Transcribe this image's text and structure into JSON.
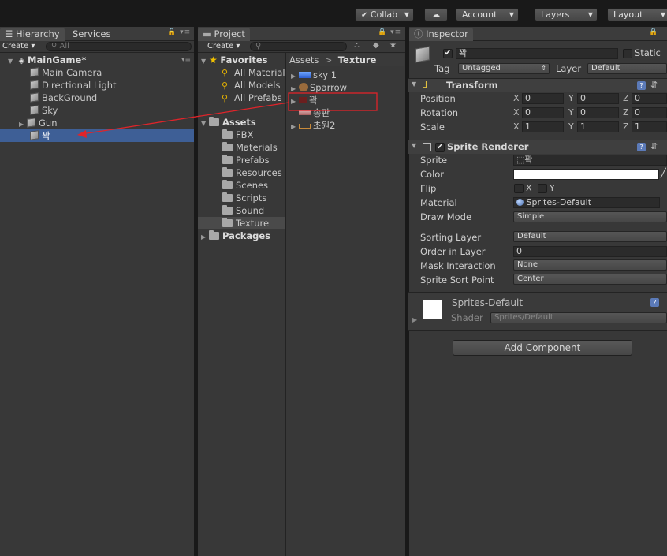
{
  "toolbar": {
    "collab": "Collab",
    "account": "Account",
    "layers": "Layers",
    "layout": "Layout"
  },
  "hierarchy": {
    "tab": "Hierarchy",
    "tab2": "Services",
    "create": "Create",
    "search_placeholder": "All",
    "scene": "MainGame*",
    "items": [
      "Main Camera",
      "Directional Light",
      "BackGround",
      "Sky",
      "Gun",
      "꽉"
    ]
  },
  "project": {
    "tab": "Project",
    "create": "Create",
    "favorites": "Favorites",
    "fav_items": [
      "All Material",
      "All Models",
      "All Prefabs"
    ],
    "assets": "Assets",
    "folders": [
      "FBX",
      "Materials",
      "Prefabs",
      "Resources",
      "Scenes",
      "Scripts",
      "Sound",
      "Texture"
    ],
    "packages": "Packages",
    "breadcrumb_root": "Assets",
    "breadcrumb_current": "Texture",
    "files": [
      "sky 1",
      "Sparrow",
      "꽉",
      "송판",
      "초원2"
    ]
  },
  "inspector": {
    "tab": "Inspector",
    "name": "꽉",
    "static": "Static",
    "tag_label": "Tag",
    "tag": "Untagged",
    "layer_label": "Layer",
    "layer": "Default",
    "transform": {
      "title": "Transform",
      "position_label": "Position",
      "rotation_label": "Rotation",
      "scale_label": "Scale",
      "position": [
        "0",
        "0",
        "0"
      ],
      "rotation": [
        "0",
        "0",
        "0"
      ],
      "scale": [
        "1",
        "1",
        "1"
      ]
    },
    "sprite_renderer": {
      "title": "Sprite Renderer",
      "sprite_label": "Sprite",
      "sprite": "꽉",
      "color_label": "Color",
      "flip_label": "Flip",
      "flip_x": "X",
      "flip_y": "Y",
      "material_label": "Material",
      "material": "Sprites-Default",
      "draw_mode_label": "Draw Mode",
      "draw_mode": "Simple",
      "sorting_layer_label": "Sorting Layer",
      "sorting_layer": "Default",
      "order_label": "Order in Layer",
      "order": "0",
      "mask_label": "Mask Interaction",
      "mask": "None",
      "sort_point_label": "Sprite Sort Point",
      "sort_point": "Center"
    },
    "material_block": {
      "name": "Sprites-Default",
      "shader_label": "Shader",
      "shader": "Sprites/Default"
    },
    "add_component": "Add Component"
  },
  "colors": {
    "selection": "#3e5f96",
    "annotation": "#e0242a"
  }
}
